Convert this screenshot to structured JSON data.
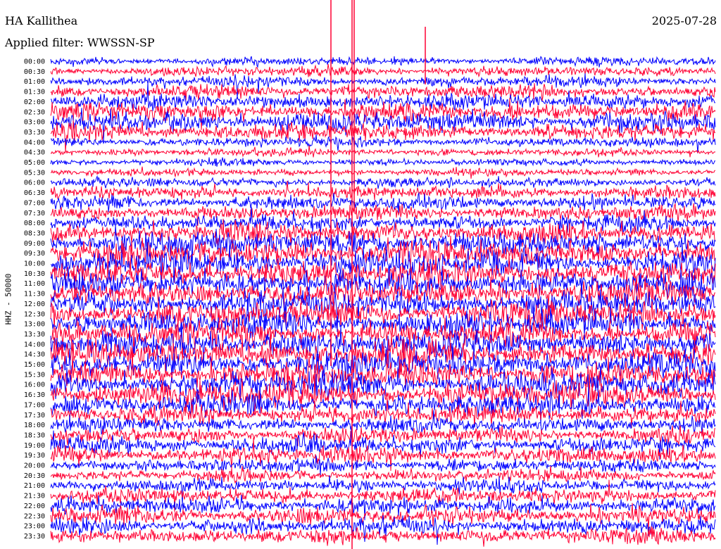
{
  "header": {
    "station": "HA Kallithea",
    "date": "2025-07-28",
    "filter": "Applied filter: WWSSN-SP"
  },
  "chart_data": {
    "type": "line",
    "title": "HA Kallithea",
    "ylabel": "HHZ - 50000",
    "grid": false,
    "legend": "none",
    "y_ticks": [
      "00:00",
      "00:30",
      "01:00",
      "01:30",
      "02:00",
      "02:30",
      "03:00",
      "03:30",
      "04:00",
      "04:30",
      "05:00",
      "05:30",
      "06:00",
      "06:30",
      "07:00",
      "07:30",
      "08:00",
      "08:30",
      "09:00",
      "09:30",
      "10:00",
      "10:30",
      "11:00",
      "11:30",
      "12:00",
      "12:30",
      "13:00",
      "13:30",
      "14:00",
      "14:30",
      "15:00",
      "15:30",
      "16:00",
      "16:30",
      "17:00",
      "17:30",
      "18:00",
      "18:30",
      "19:00",
      "19:30",
      "20:00",
      "20:30",
      "21:00",
      "21:30",
      "22:00",
      "22:30",
      "23:00",
      "23:30"
    ],
    "trace_colors": [
      "#0000ff",
      "#ff0033"
    ],
    "trace_activity": [
      0.25,
      0.3,
      0.35,
      0.45,
      0.6,
      0.7,
      0.75,
      0.6,
      0.3,
      0.2,
      0.18,
      0.2,
      0.3,
      0.45,
      0.5,
      0.55,
      0.6,
      0.75,
      0.9,
      1,
      1,
      1,
      1,
      1,
      1,
      1,
      1,
      1,
      1,
      1,
      1,
      1,
      1,
      1,
      0.85,
      0.7,
      0.55,
      0.6,
      0.65,
      0.6,
      0.45,
      0.4,
      0.45,
      0.55,
      0.6,
      0.65,
      0.6,
      0.55
    ]
  }
}
